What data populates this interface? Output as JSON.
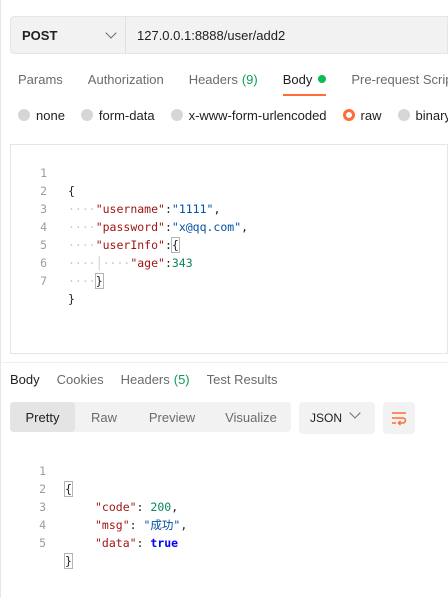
{
  "request": {
    "method": "POST",
    "url": "127.0.0.1:8888/user/add2"
  },
  "request_tabs": [
    {
      "label": "Params"
    },
    {
      "label": "Authorization"
    },
    {
      "label": "Headers",
      "count": "(9)"
    },
    {
      "label": "Body",
      "active": true,
      "indicator": "green-dot"
    },
    {
      "label": "Pre-request Script"
    }
  ],
  "body_types": [
    {
      "label": "none"
    },
    {
      "label": "form-data"
    },
    {
      "label": "x-www-form-urlencoded"
    },
    {
      "label": "raw",
      "selected": true
    },
    {
      "label": "binary"
    }
  ],
  "request_body": {
    "line_numbers": [
      "1",
      "2",
      "3",
      "4",
      "5",
      "6",
      "7"
    ],
    "lines": [
      "{",
      "\"username\":\"1111\",",
      "\"password\":\"x@qq.com\",",
      "\"userInfo\":{",
      "\"age\":343",
      "}",
      "}"
    ]
  },
  "response_tabs": [
    {
      "label": "Body",
      "active": true
    },
    {
      "label": "Cookies"
    },
    {
      "label": "Headers",
      "count": "(5)"
    },
    {
      "label": "Test Results"
    }
  ],
  "view_modes": [
    {
      "label": "Pretty",
      "active": true
    },
    {
      "label": "Raw"
    },
    {
      "label": "Preview"
    },
    {
      "label": "Visualize"
    }
  ],
  "format": "JSON",
  "wrap_icon": "wrap-lines-icon",
  "response_body": {
    "line_numbers": [
      "1",
      "2",
      "3",
      "4",
      "5"
    ],
    "lines": [
      "{",
      "\"code\": 200,",
      "\"msg\": \"成功\",",
      "\"data\": true",
      "}"
    ]
  },
  "colors": {
    "accent": "#ff6c37",
    "green": "#0cbb52",
    "key": "#a31515",
    "string": "#0451a5",
    "number": "#098658"
  }
}
